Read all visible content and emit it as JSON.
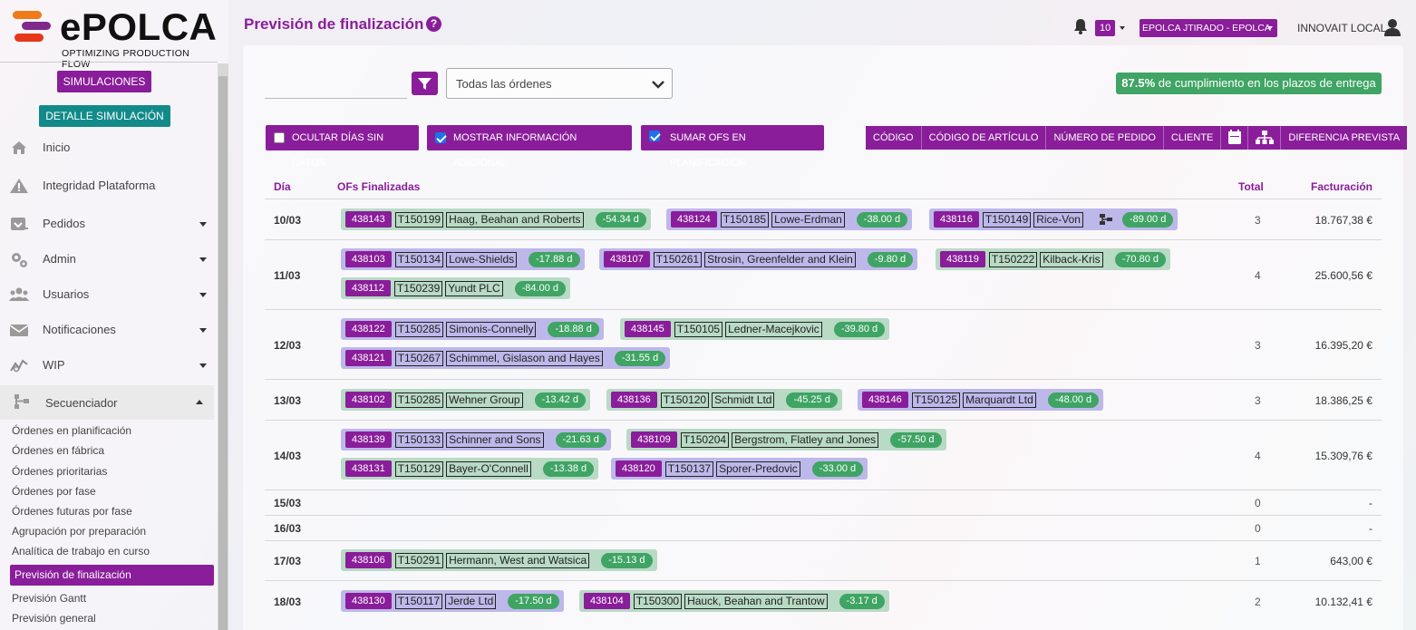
{
  "brand": {
    "name": "ePOLCA",
    "tagline": "OPTIMIZING PRODUCTION FLOW"
  },
  "sidebar": {
    "btn_simulaciones": "SIMULACIONES",
    "btn_detalle": "DETALLE SIMULACIÓN",
    "nav": [
      "Inicio",
      "Integridad Plataforma",
      "Pedidos",
      "Admin",
      "Usuarios",
      "Notificaciones",
      "WIP",
      "Secuenciador"
    ],
    "sub": [
      "Órdenes en planificación",
      "Órdenes en fábrica",
      "Órdenes prioritarias",
      "Órdenes por fase",
      "Órdenes futuras por fase",
      "Agrupación por preparación",
      "Analítica de trabajo en curso",
      "Previsión de finalización",
      "Previsión Gantt",
      "Previsión general"
    ]
  },
  "header": {
    "title": "Previsión de finalización",
    "help": "?",
    "notifications": "10",
    "company": "EPOLCA JTIRADO - EPOLCA",
    "user": "INNOVAIT LOCAL"
  },
  "filters": {
    "select_value": "Todas las órdenes",
    "compliance_pct": "87.5%",
    "compliance_text": " de cumplimiento en los plazos de entrega",
    "chk_ocultar": "OCULTAR DÍAS SIN DATOS",
    "chk_mostrar": "MOSTRAR INFORMACIÓN ADICIONAL",
    "chk_sumar": "SUMAR OFS EN PLANIFICACIÓN",
    "chk_ocultar_on": false,
    "chk_mostrar_on": true,
    "chk_sumar_on": true
  },
  "sortbar": [
    "CÓDIGO",
    "CÓDIGO DE ARTÍCULO",
    "NÚMERO DE PEDIDO",
    "CLIENTE",
    "calendar-icon",
    "hierarchy-icon",
    "DIFERENCIA PREVISTA"
  ],
  "table": {
    "headers": {
      "dia": "Día",
      "ofs": "OFs Finalizadas",
      "total": "Total",
      "facturacion": "Facturación"
    },
    "rows": [
      {
        "day": "10/03",
        "total": "3",
        "fact": "18.767,38 €",
        "ofs": [
          {
            "code": "438143",
            "art": "T150199",
            "client": "Haag, Beahan and Roberts",
            "days": "-54.34 d",
            "color": "green"
          },
          {
            "code": "438124",
            "art": "T150185",
            "client": "Lowe-Erdman",
            "days": "-38.00 d",
            "color": "blue"
          },
          {
            "code": "438116",
            "art": "T150149",
            "client": "Rice-Von",
            "days": "-89.00 d",
            "color": "blue",
            "icon": true
          }
        ]
      },
      {
        "day": "11/03",
        "total": "4",
        "fact": "25.600,56 €",
        "ofs": [
          {
            "code": "438103",
            "art": "T150134",
            "client": "Lowe-Shields",
            "days": "-17.88 d",
            "color": "blue"
          },
          {
            "code": "438107",
            "art": "T150261",
            "client": "Strosin, Greenfelder and Klein",
            "days": "-9.80 d",
            "color": "blue"
          },
          {
            "code": "438119",
            "art": "T150222",
            "client": "Kilback-Kris",
            "days": "-70.80 d",
            "color": "green"
          },
          {
            "code": "438112",
            "art": "T150239",
            "client": "Yundt PLC",
            "days": "-84.00 d",
            "color": "green"
          }
        ]
      },
      {
        "day": "12/03",
        "total": "3",
        "fact": "16.395,20 €",
        "ofs": [
          {
            "code": "438122",
            "art": "T150285",
            "client": "Simonis-Connelly",
            "days": "-18.88 d",
            "color": "blue"
          },
          {
            "code": "438145",
            "art": "T150105",
            "client": "Ledner-Macejkovic",
            "days": "-39.80 d",
            "color": "green"
          },
          {
            "code": "438121",
            "art": "T150267",
            "client": "Schimmel, Gislason and Hayes",
            "days": "-31.55 d",
            "color": "blue"
          }
        ]
      },
      {
        "day": "13/03",
        "total": "3",
        "fact": "18.386,25 €",
        "ofs": [
          {
            "code": "438102",
            "art": "T150285",
            "client": "Wehner Group",
            "days": "-13.42 d",
            "color": "green"
          },
          {
            "code": "438136",
            "art": "T150120",
            "client": "Schmidt Ltd",
            "days": "-45.25 d",
            "color": "green"
          },
          {
            "code": "438146",
            "art": "T150125",
            "client": "Marquardt Ltd",
            "days": "-48.00 d",
            "color": "blue"
          }
        ]
      },
      {
        "day": "14/03",
        "total": "4",
        "fact": "15.309,76 €",
        "ofs": [
          {
            "code": "438139",
            "art": "T150133",
            "client": "Schinner and Sons",
            "days": "-21.63 d",
            "color": "blue"
          },
          {
            "code": "438109",
            "art": "T150204",
            "client": "Bergstrom, Flatley and Jones",
            "days": "-57.50 d",
            "color": "green"
          },
          {
            "code": "438131",
            "art": "T150129",
            "client": "Bayer-O'Connell",
            "days": "-13.38 d",
            "color": "green"
          },
          {
            "code": "438120",
            "art": "T150137",
            "client": "Sporer-Predovic",
            "days": "-33.00 d",
            "color": "blue"
          }
        ]
      },
      {
        "day": "15/03",
        "total": "0",
        "fact": "-",
        "ofs": []
      },
      {
        "day": "16/03",
        "total": "0",
        "fact": "-",
        "ofs": []
      },
      {
        "day": "17/03",
        "total": "1",
        "fact": "643,00 €",
        "ofs": [
          {
            "code": "438106",
            "art": "T150291",
            "client": "Hermann, West and Watsica",
            "days": "-15.13 d",
            "color": "green"
          }
        ]
      },
      {
        "day": "18/03",
        "total": "2",
        "fact": "10.132,41 €",
        "ofs": [
          {
            "code": "438130",
            "art": "T150117",
            "client": "Jerde Ltd",
            "days": "-17.50 d",
            "color": "blue"
          },
          {
            "code": "438104",
            "art": "T150300",
            "client": "Hauck, Beahan and Trantow",
            "days": "-3.17 d",
            "color": "green"
          }
        ]
      }
    ]
  }
}
